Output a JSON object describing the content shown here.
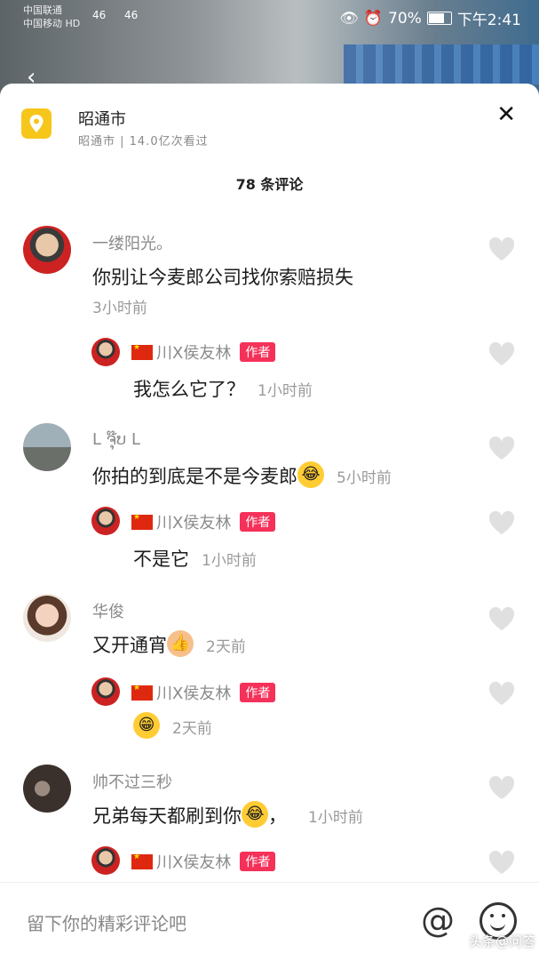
{
  "status_bar": {
    "carrier_1": "中国联通",
    "carrier_2": "中国移动 HD",
    "signal_1": "46",
    "signal_2": "46",
    "battery": "70%",
    "time": "下午2:41"
  },
  "location": {
    "title": "昭通市",
    "subtitle": "昭通市 | 14.0亿次看过"
  },
  "comment_count": "78 条评论",
  "comments": [
    {
      "name": "一缕阳光。",
      "text": "你别让今麦郎公司找你索赔损失",
      "time": "3小时前",
      "reply": {
        "name": "川X侯友林",
        "badge": "作者",
        "text": "我怎么它了？",
        "time": "1小时前"
      }
    },
    {
      "name": "L ຈຸ໊ບ L",
      "text": "你拍的到底是不是今麦郎",
      "emoji": "😂",
      "time": "5小时前",
      "reply": {
        "name": "川X侯友林",
        "badge": "作者",
        "text": "不是它",
        "time": "1小时前"
      }
    },
    {
      "name": "华俊",
      "text": "又开通宵",
      "emoji": "👍",
      "time": "2天前",
      "reply": {
        "name": "川X侯友林",
        "badge": "作者",
        "emoji": "😁",
        "time": "2天前"
      }
    },
    {
      "name": "帅不过三秒",
      "text": "兄弟每天都刷到你",
      "emoji": "😂",
      "text_suffix": "，",
      "time": "1小时前",
      "reply": {
        "name": "川X侯友林",
        "badge": "作者"
      }
    }
  ],
  "input": {
    "placeholder": "留下你的精彩评论吧"
  },
  "watermark": "头条@问答",
  "colors": {
    "accent": "#f5315a",
    "location_icon": "#f6c61b"
  }
}
